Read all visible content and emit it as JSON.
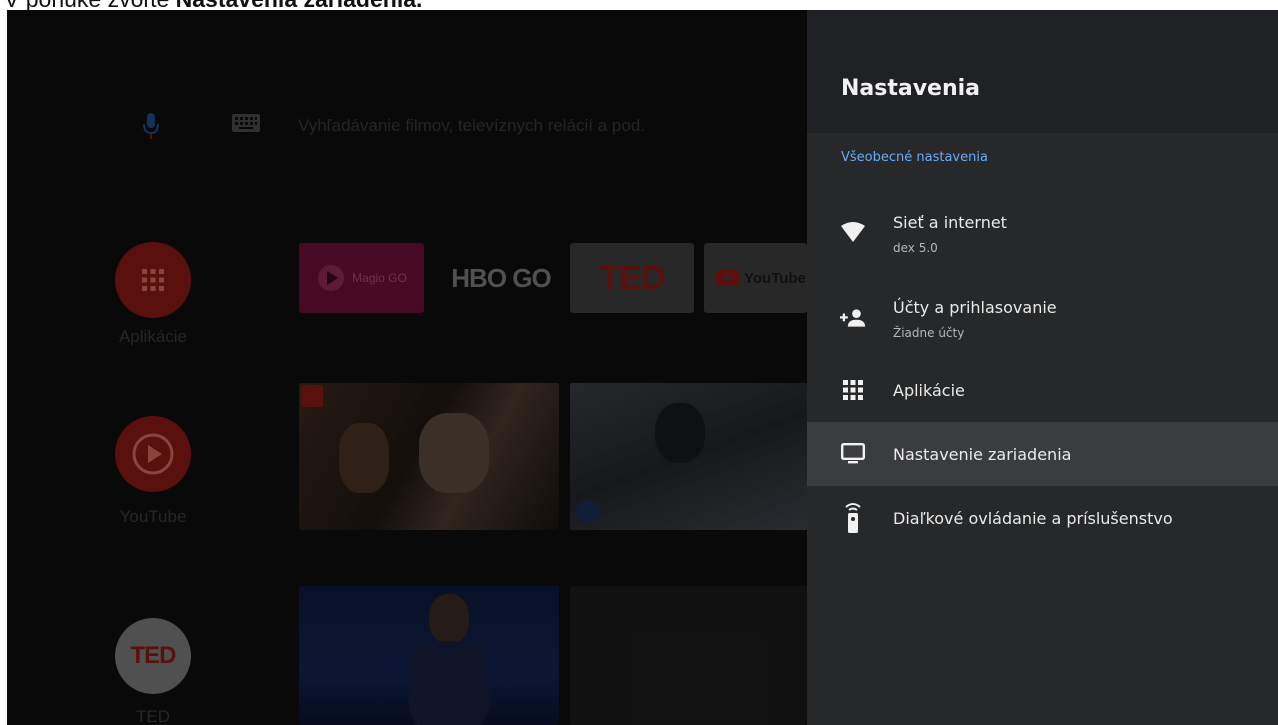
{
  "banner": {
    "prefix": "V ponuke zvoľte ",
    "emphasis": "Nastavenia zariadenia."
  },
  "home": {
    "search_placeholder": "Vyhľadávanie filmov, televíznych relácií a pod.",
    "side_apps": [
      {
        "label": "Aplikácie",
        "icon": "apps-grid-icon",
        "color": "#b3221c"
      },
      {
        "label": "YouTube",
        "icon": "play-circle-icon",
        "color": "#b3221c"
      },
      {
        "label": "TED",
        "icon": "ted-logo",
        "color": "#d7d7d7"
      }
    ],
    "channel_tiles": [
      {
        "label": "Magio GO",
        "name": "magio-go-tile"
      },
      {
        "label": "HBO GO",
        "name": "hbo-go-tile"
      },
      {
        "label": "TED",
        "name": "ted-tile"
      },
      {
        "label": "YouTube",
        "name": "youtube-tile"
      }
    ]
  },
  "settings": {
    "title": "Nastavenia",
    "section": "Všeobecné nastavenia",
    "accent_color": "#6eaaf7",
    "items": [
      {
        "label": "Sieť a internet",
        "sub": "dex 5.0",
        "icon": "wifi-icon"
      },
      {
        "label": "Účty a prihlasovanie",
        "sub": "Žiadne účty",
        "icon": "add-person-icon"
      },
      {
        "label": "Aplikácie",
        "sub": "",
        "icon": "apps-grid-icon"
      },
      {
        "label": "Nastavenie zariadenia",
        "sub": "",
        "icon": "tv-monitor-icon",
        "selected": true
      },
      {
        "label": "Diaľkové ovládanie a príslušenstvo",
        "sub": "",
        "icon": "remote-control-icon"
      }
    ]
  }
}
